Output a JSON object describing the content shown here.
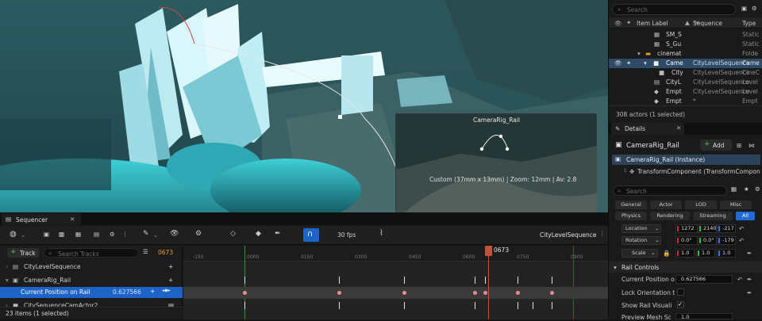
{
  "viewport": {
    "preview_title": "CameraRig_Rail",
    "preview_info": "Custom (37mm x 13mm) | Zoom: 12mm | Av: 2.8"
  },
  "outliner": {
    "search_placeholder": "Search",
    "col_item_label": "Item Label",
    "col_sequence": "Sequence",
    "col_type": "Type",
    "rows": [
      {
        "label": "SM_S",
        "sequence": "",
        "type": "Static"
      },
      {
        "label": "S_Gu",
        "sequence": "",
        "type": "Static"
      },
      {
        "label": "cinemat",
        "sequence": "",
        "type": "Folde"
      },
      {
        "label": "Came",
        "sequence": "CityLevelSequence",
        "type": "Came"
      },
      {
        "label": "City",
        "sequence": "CityLevelSequence",
        "type": "CineC"
      },
      {
        "label": "CityL",
        "sequence": "CityLevelSequence",
        "type": "Level"
      },
      {
        "label": "Empt",
        "sequence": "CityLevelSequence",
        "type": "Level"
      },
      {
        "label": "Empt",
        "sequence": "*",
        "type": "Empt"
      }
    ],
    "footer": "308 actors (1 selected)"
  },
  "details": {
    "tab": "Details",
    "component": "CameraRig_Rail",
    "add_label": "Add",
    "instance": "CameraRig_Rail (Instance)",
    "transform": "TransformComponent (TransformCompon",
    "search_placeholder": "Search",
    "filters_row1": [
      "General",
      "Actor",
      "LOD",
      "Misc"
    ],
    "filters_row2": [
      "Physics",
      "Rendering",
      "Streaming",
      "All"
    ],
    "location": {
      "label": "Location",
      "x": "1272",
      "y": "2140",
      "z": "-217"
    },
    "rotation": {
      "label": "Rotation",
      "x": "0.0°",
      "y": "0.0°",
      "z": "-179"
    },
    "scale": {
      "label": "Scale",
      "x": "1.0",
      "y": "1.0",
      "z": "1.0"
    },
    "rail_section": "Rail Controls",
    "current_pos_label": "Current Position o",
    "current_pos_value": "0.627566",
    "lock_orientation": "Lock Orientation t",
    "show_rail": "Show Rail Visuali",
    "preview_mesh": "Preview Mesh Sc",
    "preview_mesh_value": "1.0"
  },
  "sequencer": {
    "tab": "Sequencer",
    "fps": "30 fps",
    "sequence_name": "CityLevelSequence",
    "track_label": "Track",
    "search_placeholder": "Search Tracks",
    "current_frame": "0673",
    "ruler": [
      "-150",
      "0000",
      "0150",
      "0300",
      "0450",
      "0600",
      "0750",
      "0900"
    ],
    "playhead_label": "0673",
    "tracks": [
      {
        "label": "CityLevelSequence"
      },
      {
        "label": "CameraRig_Rail"
      },
      {
        "label": "Current Position on Rail",
        "value": "0.627566"
      },
      {
        "label": "CitySequenceCamActor2"
      }
    ],
    "status": "23 items (1 selected)"
  }
}
